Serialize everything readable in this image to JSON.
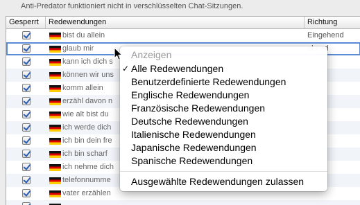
{
  "notice": "Anti-Predator funktioniert nicht in verschlüsselten Chat-Sitzungen.",
  "table": {
    "headers": {
      "blocked": "Gesperrt",
      "phrase": "Redewendungen",
      "direction": "Richtung"
    },
    "rows": [
      {
        "blocked": true,
        "phrase": "bist du allein",
        "direction": "Eingehend"
      },
      {
        "blocked": true,
        "phrase": "glaub mir",
        "direction": "ehend",
        "selected": true
      },
      {
        "blocked": true,
        "phrase": "kann ich dich s",
        "direction": ""
      },
      {
        "blocked": true,
        "phrase": "können wir uns",
        "direction": ""
      },
      {
        "blocked": true,
        "phrase": "komm allein",
        "direction": ""
      },
      {
        "blocked": true,
        "phrase": "erzähl davon n",
        "direction": ""
      },
      {
        "blocked": true,
        "phrase": "wie alt bist du",
        "direction": ""
      },
      {
        "blocked": true,
        "phrase": "ich werde dich",
        "direction": ""
      },
      {
        "blocked": true,
        "phrase": "ich bin dein fre",
        "direction": ""
      },
      {
        "blocked": true,
        "phrase": "ich bin scharf",
        "direction": ""
      },
      {
        "blocked": true,
        "phrase": "ich nehme dich",
        "direction": ""
      },
      {
        "blocked": true,
        "phrase": "telefonnumme",
        "direction": ""
      },
      {
        "blocked": true,
        "phrase": "vater erzählen",
        "direction": ""
      },
      {
        "blocked": true,
        "phrase": "",
        "direction": ""
      }
    ]
  },
  "menu": {
    "header": "Anzeigen",
    "items": [
      {
        "label": "Alle Redewendungen",
        "checked": true
      },
      {
        "label": "Benutzerdefinierte Redewendungen",
        "checked": false
      },
      {
        "label": "Englische Redewendungen",
        "checked": false
      },
      {
        "label": "Französische Redewendungen",
        "checked": false
      },
      {
        "label": "Deutsche Redewendungen",
        "checked": false
      },
      {
        "label": "Italienische Redewendungen",
        "checked": false
      },
      {
        "label": "Japanische Redewendungen",
        "checked": false
      },
      {
        "label": "Spanische Redewendungen",
        "checked": false
      }
    ],
    "action": "Ausgewählte Redewendungen zulassen",
    "check_glyph": "✓"
  },
  "colors": {
    "selection_outline": "#5c8bd6",
    "alt_row": "#f1f5fa",
    "checkmark": "#2a5db0"
  },
  "icons": {
    "flag": "german-flag-icon",
    "cursor": "mouse-pointer-icon"
  }
}
